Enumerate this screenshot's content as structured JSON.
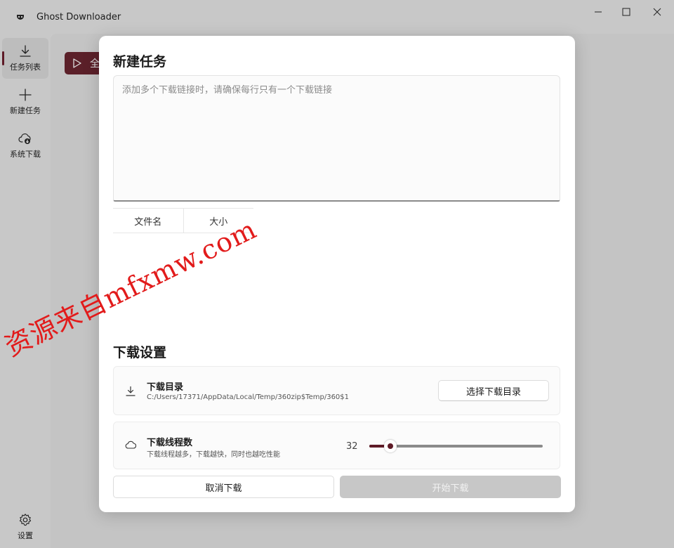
{
  "window": {
    "title": "Ghost Downloader"
  },
  "sidebar": {
    "items": [
      {
        "label": "任务列表",
        "icon": "download-icon"
      },
      {
        "label": "新建任务",
        "icon": "plus-icon"
      },
      {
        "label": "系统下载",
        "icon": "cloud-download-icon"
      }
    ],
    "settings_label": "设置"
  },
  "background": {
    "button_label": "全"
  },
  "dialog": {
    "title": "新建任务",
    "url_placeholder": "添加多个下载链接时，请确保每行只有一个下载链接",
    "table": {
      "columns": [
        "文件名",
        "大小"
      ]
    },
    "settings_title": "下载设置",
    "directory": {
      "title": "下载目录",
      "path": "C:/Users/17371/AppData/Local/Temp/360zip$Temp/360$1",
      "button_label": "选择下载目录"
    },
    "threads": {
      "title": "下载线程数",
      "description": "下载线程越多，下载越快，同时也越吃性能",
      "value": "32",
      "slider_fraction": 0.12
    },
    "cancel_label": "取消下载",
    "start_label": "开始下载"
  },
  "watermark": "资源来自mfxmw.com",
  "colors": {
    "accent": "#5e1a26",
    "watermark": "#e21b1b"
  }
}
